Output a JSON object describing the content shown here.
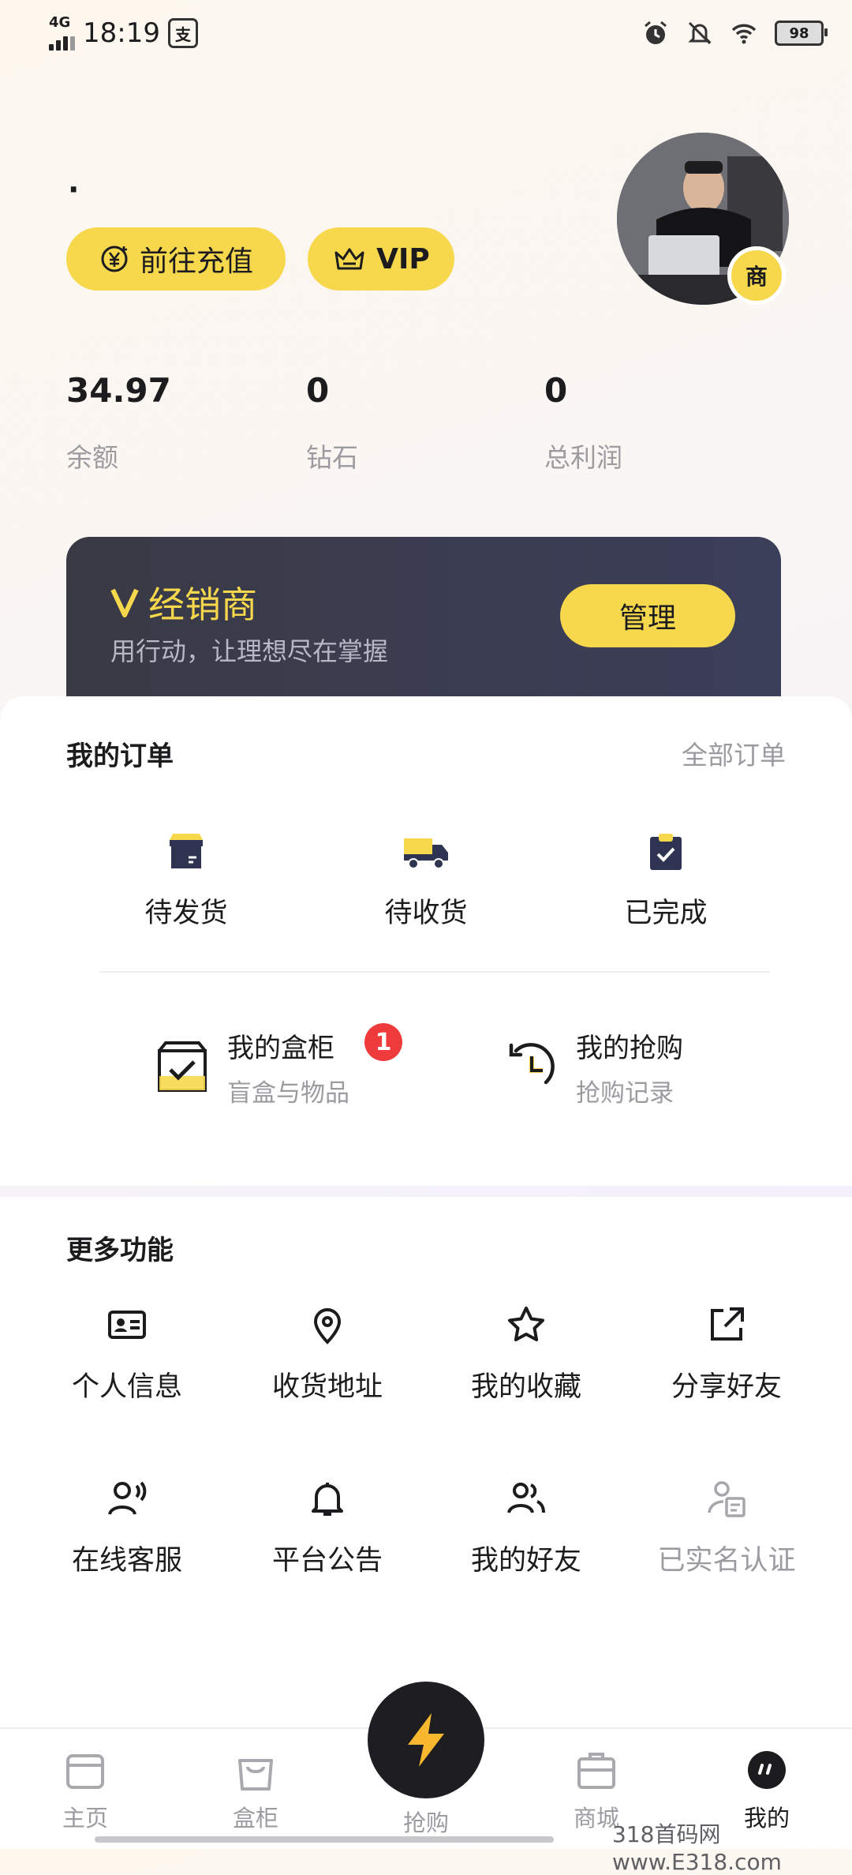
{
  "status_bar": {
    "network": "4G",
    "time": "18:19",
    "app_badge": "支",
    "battery": "98"
  },
  "profile": {
    "name": "·",
    "recharge_label": "前往充值",
    "vip_label": "VIP",
    "merchant_badge": "商"
  },
  "stats": [
    {
      "value": "34.97",
      "label": "余额"
    },
    {
      "value": "0",
      "label": "钻石"
    },
    {
      "value": "0",
      "label": "总利润"
    }
  ],
  "dealer": {
    "title": "经销商",
    "subtitle": "用行动，让理想尽在掌握",
    "button": "管理"
  },
  "orders": {
    "title": "我的订单",
    "all_link": "全部订单",
    "items": [
      {
        "label": "待发货",
        "icon": "box-icon"
      },
      {
        "label": "待收货",
        "icon": "truck-icon"
      },
      {
        "label": "已完成",
        "icon": "clipboard-check-icon"
      }
    ]
  },
  "quick": [
    {
      "title": "我的盒柜",
      "subtitle": "盲盒与物品",
      "badge": "1",
      "icon": "box-check-icon"
    },
    {
      "title": "我的抢购",
      "subtitle": "抢购记录",
      "icon": "history-clock-icon"
    }
  ],
  "more": {
    "title": "更多功能",
    "items": [
      {
        "label": "个人信息",
        "icon": "id-card-icon"
      },
      {
        "label": "收货地址",
        "icon": "location-pin-icon"
      },
      {
        "label": "我的收藏",
        "icon": "star-icon"
      },
      {
        "label": "分享好友",
        "icon": "share-icon"
      },
      {
        "label": "在线客服",
        "icon": "customer-service-icon"
      },
      {
        "label": "平台公告",
        "icon": "bell-icon"
      },
      {
        "label": "我的好友",
        "icon": "friends-icon"
      },
      {
        "label": "已实名认证",
        "icon": "verified-id-icon"
      }
    ]
  },
  "tabbar": {
    "items": [
      {
        "label": "主页",
        "icon": "home-box-icon"
      },
      {
        "label": "盒柜",
        "icon": "bag-icon"
      },
      {
        "label": "抢购",
        "icon": "lightning-icon"
      },
      {
        "label": "商城",
        "icon": "shop-icon"
      },
      {
        "label": "我的",
        "icon": "profile-icon"
      }
    ],
    "active": "我的"
  },
  "watermark": "318首码网 www.E318.com",
  "colors": {
    "accent": "#f7d84d",
    "dark_card": "#3b3d50",
    "badge_red": "#ef3b3b",
    "muted": "#9b9ba0"
  }
}
